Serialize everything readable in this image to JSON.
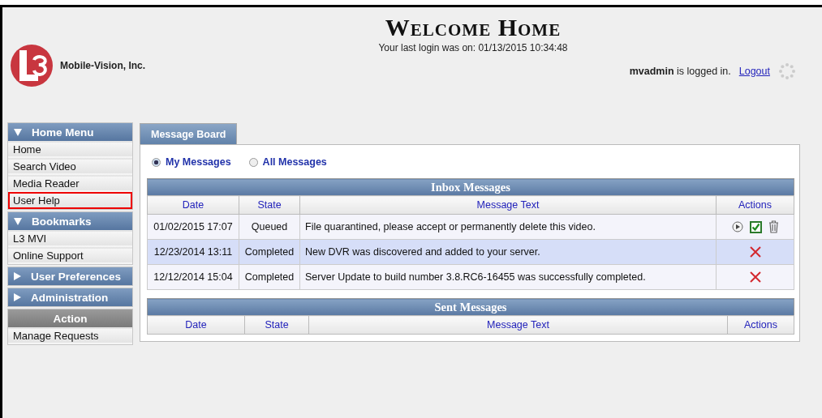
{
  "header": {
    "company": "Mobile-Vision, Inc.",
    "title": "Welcome Home",
    "last_login": "Your last login was on: 01/13/2015 10:34:48",
    "user": "mvadmin",
    "user_suffix": "is logged in.",
    "logout": "Logout"
  },
  "sidebar": {
    "sections": [
      {
        "title": "Home Menu",
        "kind": "menu",
        "expanded": true,
        "items": [
          {
            "label": "Home",
            "highlighted": false
          },
          {
            "label": "Search Video",
            "highlighted": false
          },
          {
            "label": "Media Reader",
            "highlighted": false
          },
          {
            "label": "User Help",
            "highlighted": true
          }
        ]
      },
      {
        "title": "Bookmarks",
        "kind": "menu",
        "expanded": true,
        "items": [
          {
            "label": "L3 MVI",
            "highlighted": false
          },
          {
            "label": "Online Support",
            "highlighted": false
          }
        ]
      },
      {
        "title": "User Preferences",
        "kind": "menu",
        "expanded": false
      },
      {
        "title": "Administration",
        "kind": "menu",
        "expanded": false
      },
      {
        "title": "Action",
        "kind": "action",
        "items": [
          {
            "label": "Manage Requests",
            "highlighted": false
          }
        ]
      }
    ]
  },
  "tabs": [
    {
      "label": "Message Board",
      "selected": true
    }
  ],
  "filters": [
    {
      "label": "My Messages",
      "selected": true
    },
    {
      "label": "All Messages",
      "selected": false
    }
  ],
  "inbox": {
    "title": "Inbox Messages",
    "columns": [
      "Date",
      "State",
      "Message Text",
      "Actions"
    ],
    "rows": [
      {
        "date": "01/02/2015 17:07",
        "state": "Queued",
        "text": "File quarantined, please accept or permanently delete this video.",
        "selected": false,
        "kind": "review"
      },
      {
        "date": "12/23/2014 13:11",
        "state": "Completed",
        "text": "New DVR was discovered and added to your server.",
        "selected": true,
        "kind": "dismiss"
      },
      {
        "date": "12/12/2014 15:04",
        "state": "Completed",
        "text": "Server Update to build number 3.8.RC6-16455 was successfully completed.",
        "selected": false,
        "kind": "dismiss"
      }
    ]
  },
  "sent": {
    "title": "Sent Messages",
    "columns": [
      "Date",
      "State",
      "Message Text",
      "Actions"
    ]
  }
}
